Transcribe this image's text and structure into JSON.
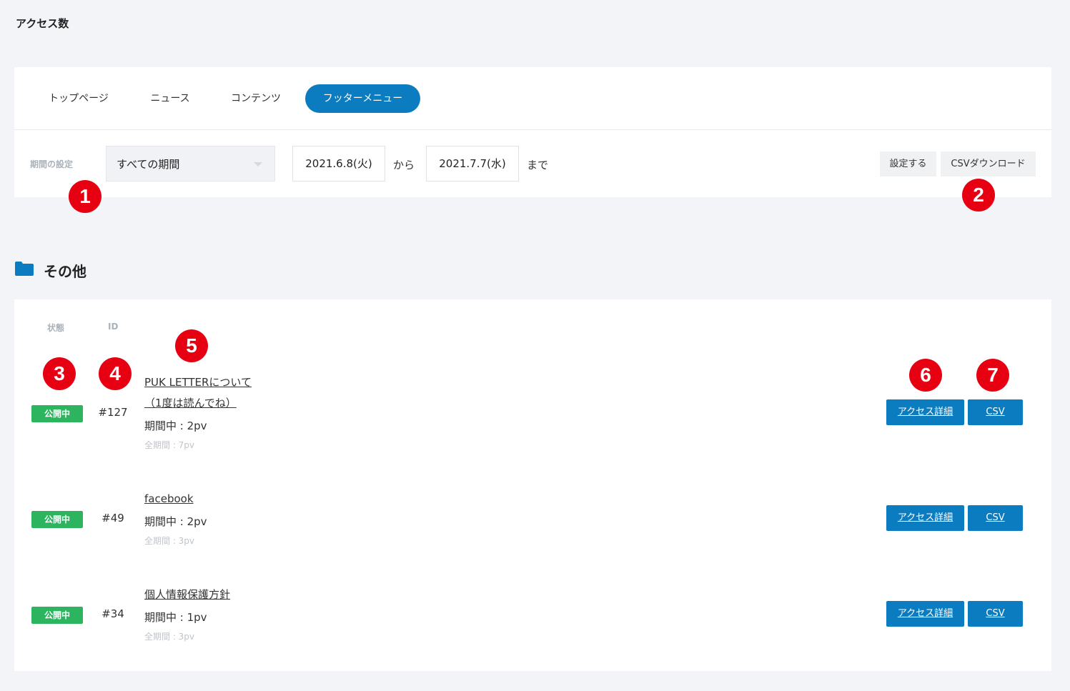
{
  "page_title": "アクセス数",
  "tabs": [
    {
      "label": "トップページ",
      "active": false
    },
    {
      "label": "ニュース",
      "active": false
    },
    {
      "label": "コンテンツ",
      "active": false
    },
    {
      "label": "フッターメニュー",
      "active": true
    }
  ],
  "filter": {
    "period_label": "期間の設定",
    "period_select_value": "すべての期間",
    "start_date": "2021.6.8(火)",
    "from_text": "から",
    "end_date": "2021.7.7(水)",
    "until_text": "まで",
    "apply_label": "設定する",
    "csv_download_label": "CSVダウンロード"
  },
  "callouts": [
    "1",
    "2",
    "3",
    "4",
    "5",
    "6",
    "7"
  ],
  "section": {
    "title": "その他",
    "icon": "folder-icon"
  },
  "list": {
    "headers": {
      "status": "状態",
      "id": "ID"
    },
    "rows": [
      {
        "status": "公開中",
        "id": "#127",
        "title_line1": "PUK LETTERについて",
        "title_line2": "（1度は読んでね）",
        "period_pv": "期間中 : 2pv",
        "total_pv": "全期間 : 7pv",
        "detail_label": "アクセス詳細",
        "csv_label": "CSV"
      },
      {
        "status": "公開中",
        "id": "#49",
        "title_line1": "facebook",
        "title_line2": "",
        "period_pv": "期間中 : 2pv",
        "total_pv": "全期間 : 3pv",
        "detail_label": "アクセス詳細",
        "csv_label": "CSV"
      },
      {
        "status": "公開中",
        "id": "#34",
        "title_line1": "個人情報保護方針",
        "title_line2": "",
        "period_pv": "期間中 : 1pv",
        "total_pv": "全期間 : 3pv",
        "detail_label": "アクセス詳細",
        "csv_label": "CSV"
      }
    ]
  },
  "colors": {
    "accent": "#0c7cc0",
    "status_green": "#2cb45f",
    "callout_red": "#e60012",
    "background": "#f2f4f7"
  }
}
